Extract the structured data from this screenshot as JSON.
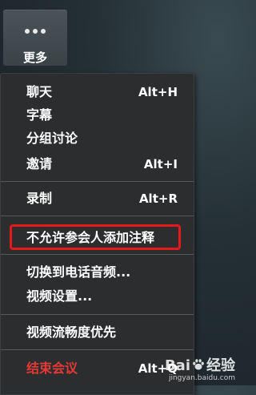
{
  "more_button": {
    "icon": "ellipsis-icon",
    "label": "更多"
  },
  "menu": {
    "items": [
      {
        "label": "聊天",
        "shortcut": "Alt+H"
      },
      {
        "label": "字幕",
        "shortcut": ""
      },
      {
        "label": "分组讨论",
        "shortcut": ""
      },
      {
        "label": "邀请",
        "shortcut": "Alt+I"
      },
      {
        "label": "录制",
        "shortcut": "Alt+R"
      },
      {
        "label": "不允许参会人添加注释",
        "shortcut": ""
      },
      {
        "label": "切换到电话音频...",
        "shortcut": ""
      },
      {
        "label": "视频设置...",
        "shortcut": ""
      },
      {
        "label": "视频流畅度优先",
        "shortcut": ""
      },
      {
        "label": "结束会议",
        "shortcut": "Alt+Q"
      }
    ],
    "highlight_color": "#e8171b",
    "danger_color": "#e53935"
  },
  "watermark": {
    "brand_left": "Bai",
    "brand_right": "经验",
    "sub": "jingyan.baidu.com"
  }
}
